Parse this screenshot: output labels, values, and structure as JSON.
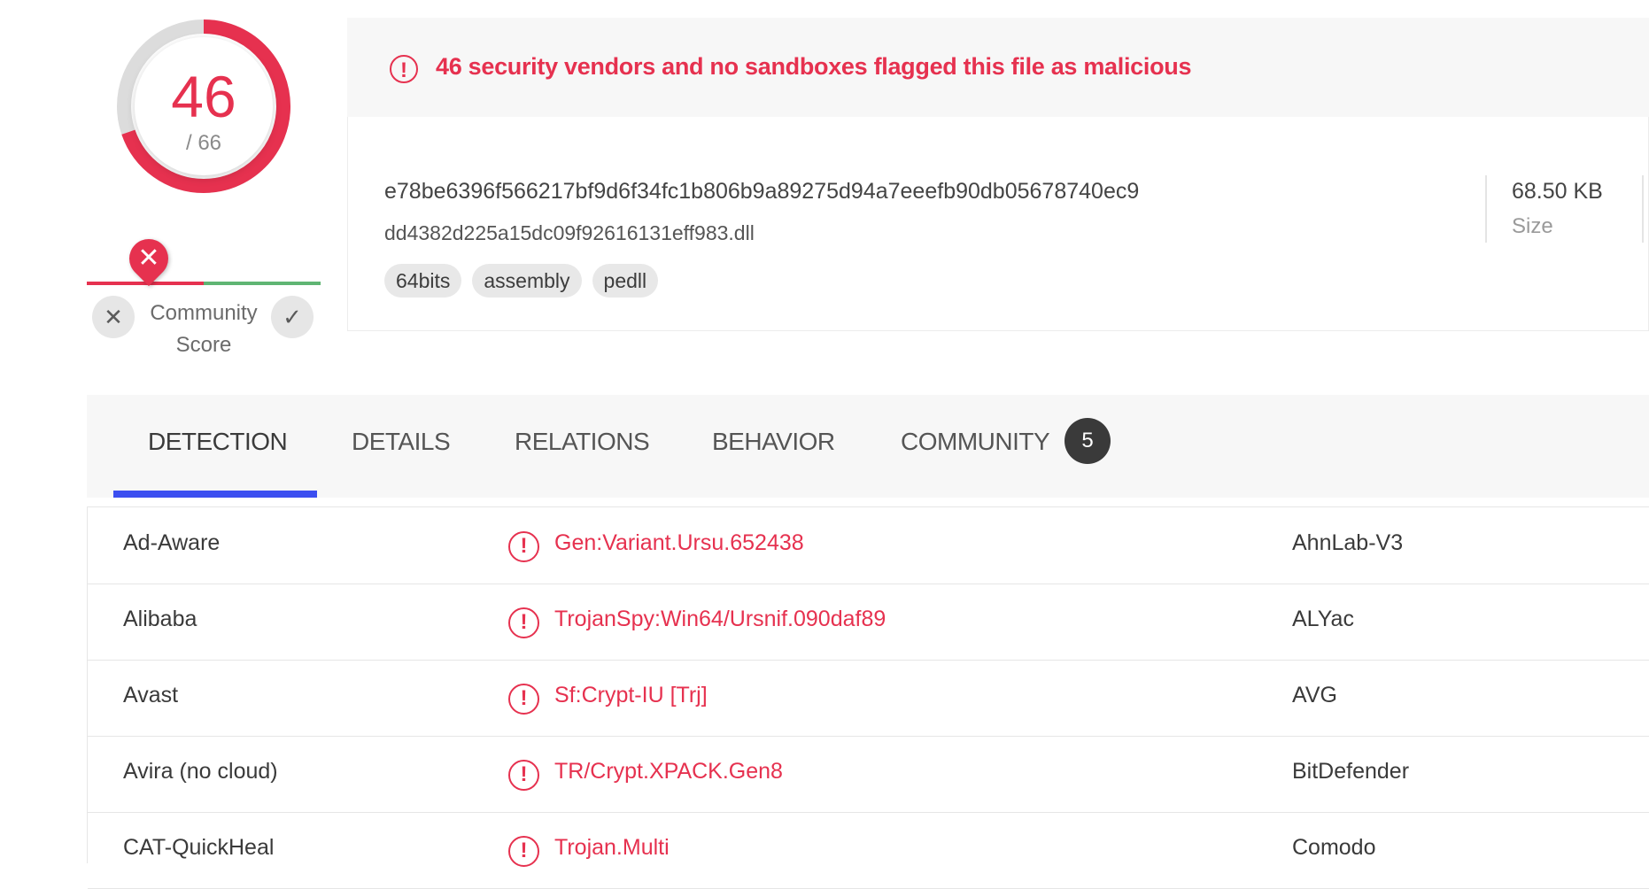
{
  "score": {
    "detected": "46",
    "total": "/ 66",
    "ratio": 0.697,
    "color": "#e6314f"
  },
  "community": {
    "label_line1": "Community",
    "label_line2": "Score",
    "downvote_icon": "x-icon",
    "upvote_icon": "check-icon",
    "marker_icon": "x-marker-icon"
  },
  "alert": {
    "icon": "alert-circle-icon",
    "text": "46 security vendors and no sandboxes flagged this file as malicious"
  },
  "file": {
    "hash": "e78be6396f566217bf9d6f34fc1b806b9a89275d94a7eeefb90db05678740ec9",
    "name": "dd4382d225a15dc09f92616131eff983.dll",
    "tags": [
      "64bits",
      "assembly",
      "pedll"
    ],
    "size_value": "68.50 KB",
    "size_label": "Size"
  },
  "tabs": {
    "detection": "DETECTION",
    "details": "DETAILS",
    "relations": "RELATIONS",
    "behavior": "BEHAVIOR",
    "community": "COMMUNITY",
    "community_badge": "5",
    "active": "detection"
  },
  "detections": [
    {
      "vendor": "Ad-Aware",
      "result": "Gen:Variant.Ursu.652438",
      "vendor2": "AhnLab-V3"
    },
    {
      "vendor": "Alibaba",
      "result": "TrojanSpy:Win64/Ursnif.090daf89",
      "vendor2": "ALYac"
    },
    {
      "vendor": "Avast",
      "result": "Sf:Crypt-IU [Trj]",
      "vendor2": "AVG"
    },
    {
      "vendor": "Avira (no cloud)",
      "result": "TR/Crypt.XPACK.Gen8",
      "vendor2": "BitDefender"
    },
    {
      "vendor": "CAT-QuickHeal",
      "result": "Trojan.Multi",
      "vendor2": "Comodo"
    }
  ],
  "colors": {
    "malicious": "#e6314f",
    "clean": "#5fb573",
    "active_tab": "#3b4ef0"
  }
}
